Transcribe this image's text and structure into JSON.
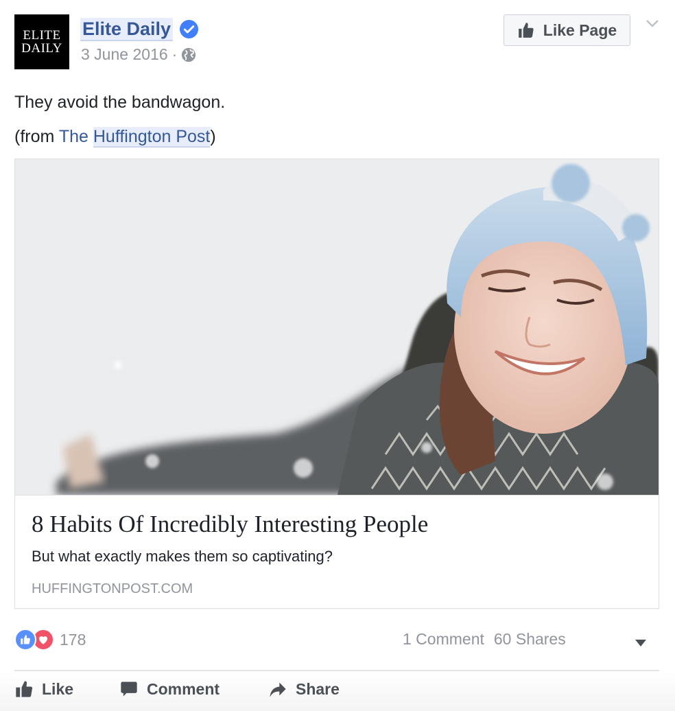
{
  "header": {
    "avatar_lines": [
      "ELITE",
      "DAILY"
    ],
    "page_name": "Elite Daily",
    "verified_icon": "verified-badge-icon",
    "date": "3 June 2016",
    "separator": "·",
    "privacy_icon": "globe-icon",
    "like_page_label": "Like Page",
    "more_icon": "chevron-down-icon"
  },
  "post": {
    "text": "They avoid the bandwagon.",
    "source_prefix": "(from ",
    "source_the": "The",
    "source_name": "Huffington Post",
    "source_suffix": ")"
  },
  "link_card": {
    "image_alt": "Smiling woman in blue knit hat and patterned scarf in the snow",
    "title": "8 Habits Of Incredibly Interesting People",
    "description": "But what exactly makes them so captivating?",
    "domain": "HUFFINGTONPOST.COM"
  },
  "stats": {
    "reaction_icons": [
      "like-reaction-icon",
      "love-reaction-icon"
    ],
    "reaction_count": "178",
    "comments": "1 Comment",
    "shares": "60 Shares"
  },
  "actions": {
    "like": "Like",
    "comment": "Comment",
    "share": "Share"
  },
  "colors": {
    "link": "#365899",
    "meta": "#90949c",
    "like_reaction": "#5890ff",
    "love_reaction": "#f25268"
  }
}
